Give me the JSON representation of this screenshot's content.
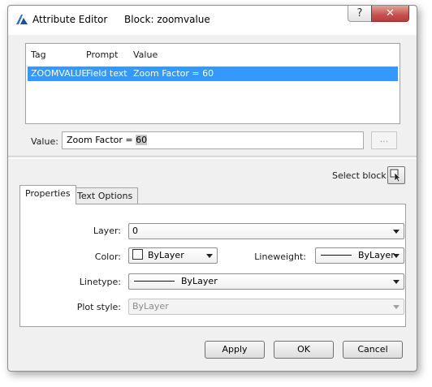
{
  "window": {
    "title": "Attribute Editor",
    "block_label": "Block: zoomvalue",
    "help_glyph": "?",
    "close_glyph": "✕"
  },
  "grid": {
    "columns": [
      "Tag",
      "Prompt",
      "Value"
    ],
    "rows": [
      {
        "tag": "ZOOMVALUE",
        "prompt": "Field text",
        "value": "Zoom Factor = 60",
        "selected": true
      }
    ]
  },
  "value_field": {
    "label": "Value:",
    "text_prefix": "Zoom Factor = ",
    "text_selected": "60",
    "ellipsis_label": "..."
  },
  "select_block": {
    "label": "Select block",
    "icon": "select-pointer-icon"
  },
  "tabs": [
    {
      "label": "Properties",
      "active": true
    },
    {
      "label": "Text Options",
      "active": false
    }
  ],
  "properties": {
    "layer": {
      "label": "Layer:",
      "value": "0"
    },
    "color": {
      "label": "Color:",
      "value": "ByLayer"
    },
    "lineweight": {
      "label": "Lineweight:",
      "value": "ByLayer"
    },
    "linetype": {
      "label": "Linetype:",
      "value": "ByLayer"
    },
    "plot_style": {
      "label": "Plot style:",
      "value": "ByLayer",
      "disabled": true
    }
  },
  "buttons": {
    "apply": "Apply",
    "ok": "OK",
    "cancel": "Cancel"
  },
  "colors": {
    "selection": "#3399ff",
    "close_button": "#c75050",
    "logo": "#2a6fc9"
  }
}
